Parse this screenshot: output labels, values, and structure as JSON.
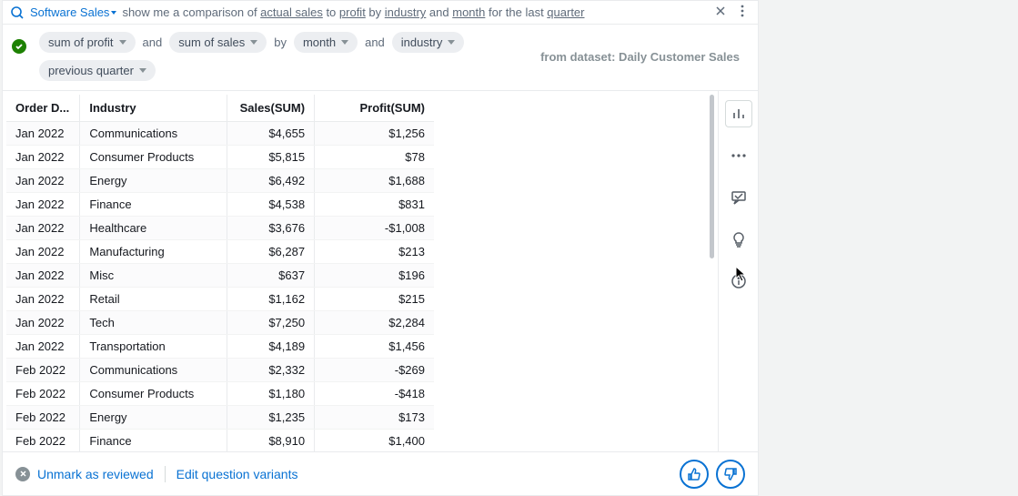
{
  "header": {
    "topic": "Software Sales",
    "query_parts": {
      "p0": "show me a comparison of ",
      "u0": "actual sales",
      "p1": " to ",
      "u1": "profit",
      "p2": " by ",
      "u2": "industry",
      "p3": " and ",
      "u3": "month",
      "p4": " for the last ",
      "u4": "quarter"
    }
  },
  "pills": {
    "sum_profit": "sum of profit",
    "and1": "and",
    "sum_sales": "sum of sales",
    "by": "by",
    "month": "month",
    "and2": "and",
    "industry": "industry",
    "prev_quarter": "previous quarter"
  },
  "dataset_label": "from dataset: Daily Customer Sales",
  "table": {
    "headers": {
      "order_date": "Order D...",
      "industry": "Industry",
      "sales": "Sales(SUM)",
      "profit": "Profit(SUM)"
    },
    "rows": [
      {
        "d": "Jan 2022",
        "i": "Communications",
        "s": "$4,655",
        "p": "$1,256"
      },
      {
        "d": "Jan 2022",
        "i": "Consumer Products",
        "s": "$5,815",
        "p": "$78"
      },
      {
        "d": "Jan 2022",
        "i": "Energy",
        "s": "$6,492",
        "p": "$1,688"
      },
      {
        "d": "Jan 2022",
        "i": "Finance",
        "s": "$4,538",
        "p": "$831"
      },
      {
        "d": "Jan 2022",
        "i": "Healthcare",
        "s": "$3,676",
        "p": "-$1,008"
      },
      {
        "d": "Jan 2022",
        "i": "Manufacturing",
        "s": "$6,287",
        "p": "$213"
      },
      {
        "d": "Jan 2022",
        "i": "Misc",
        "s": "$637",
        "p": "$196"
      },
      {
        "d": "Jan 2022",
        "i": "Retail",
        "s": "$1,162",
        "p": "$215"
      },
      {
        "d": "Jan 2022",
        "i": "Tech",
        "s": "$7,250",
        "p": "$2,284"
      },
      {
        "d": "Jan 2022",
        "i": "Transportation",
        "s": "$4,189",
        "p": "$1,456"
      },
      {
        "d": "Feb 2022",
        "i": "Communications",
        "s": "$2,332",
        "p": "-$269"
      },
      {
        "d": "Feb 2022",
        "i": "Consumer Products",
        "s": "$1,180",
        "p": "-$418"
      },
      {
        "d": "Feb 2022",
        "i": "Energy",
        "s": "$1,235",
        "p": "$173"
      },
      {
        "d": "Feb 2022",
        "i": "Finance",
        "s": "$8,910",
        "p": "$1,400"
      }
    ]
  },
  "footer": {
    "unmark": "Unmark as reviewed",
    "edit_variants": "Edit question variants"
  }
}
